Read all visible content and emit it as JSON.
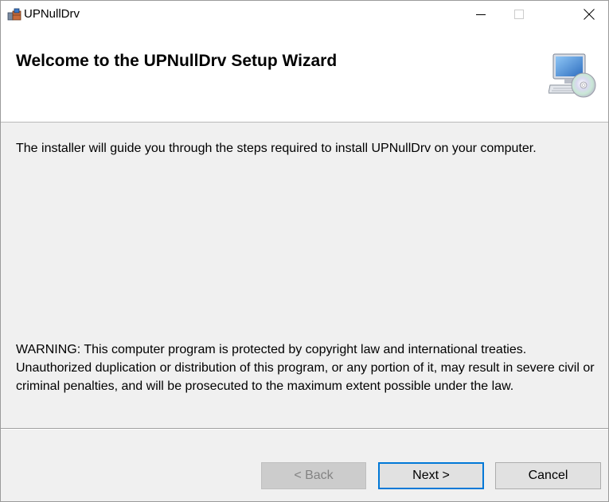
{
  "window": {
    "title": "UPNullDrv"
  },
  "header": {
    "title": "Welcome to the UPNullDrv Setup Wizard"
  },
  "body": {
    "intro": "The installer will guide you through the steps required to install UPNullDrv on your computer.",
    "warning": "WARNING: This computer program is protected by copyright law and international treaties. Unauthorized duplication or distribution of this program, or any portion of it, may result in severe civil or criminal penalties, and will be prosecuted to the maximum extent possible under the law."
  },
  "buttons": {
    "back_label": "< Back",
    "next_label": "Next >",
    "cancel_label": "Cancel"
  },
  "icons": {
    "app": "installer-icon",
    "minimize": "minimize-icon",
    "maximize": "maximize-icon",
    "close": "close-icon",
    "header": "computer-cd-icon"
  },
  "colors": {
    "focus_accent": "#0078d7",
    "window_bg": "#f0f0f0",
    "header_bg": "#ffffff"
  }
}
